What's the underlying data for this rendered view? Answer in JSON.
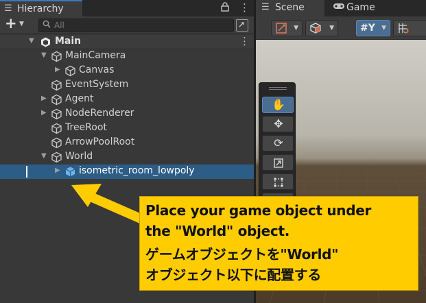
{
  "hierarchy": {
    "tab_title": "Hierarchy",
    "tab_icon": "☰",
    "lock_icon": "lock-icon",
    "more_icon": "kebab-icon",
    "search_placeholder": "All",
    "scene": {
      "name": "Main"
    },
    "items": [
      {
        "name": "MainCamera",
        "depth": 1,
        "expanded": true
      },
      {
        "name": "Canvas",
        "depth": 2,
        "expanded": false
      },
      {
        "name": "EventSystem",
        "depth": 1,
        "expanded": null
      },
      {
        "name": "Agent",
        "depth": 1,
        "expanded": false
      },
      {
        "name": "NodeRenderer",
        "depth": 1,
        "expanded": false
      },
      {
        "name": "TreeRoot",
        "depth": 1,
        "expanded": null
      },
      {
        "name": "ArrowPoolRoot",
        "depth": 1,
        "expanded": null
      },
      {
        "name": "World",
        "depth": 1,
        "expanded": true
      },
      {
        "name": "isometric_room_lowpoly",
        "depth": 2,
        "expanded": false,
        "selected": true,
        "prefab": true
      }
    ]
  },
  "scene_view": {
    "tabs": [
      {
        "label": "Scene",
        "icon": "scene-grid-icon",
        "active": true
      },
      {
        "label": "Game",
        "icon": "gamepad-icon",
        "active": false
      }
    ],
    "tools": [
      "hand-tool",
      "move-tool",
      "rotate-tool",
      "scale-tool",
      "rect-tool",
      "transform-tool",
      "custom-tool"
    ],
    "active_tool": "hand-tool"
  },
  "callout": {
    "lines": [
      "Place your game object under",
      "the \"World\" object.",
      "ゲームオブジェクトを\"World\"",
      "オブジェクト以下に配置する"
    ],
    "bg_color": "#ffcc00"
  },
  "colors": {
    "selection": "#2c5d87",
    "accent_tab": "#3a79bb",
    "callout": "#ffcc00"
  }
}
